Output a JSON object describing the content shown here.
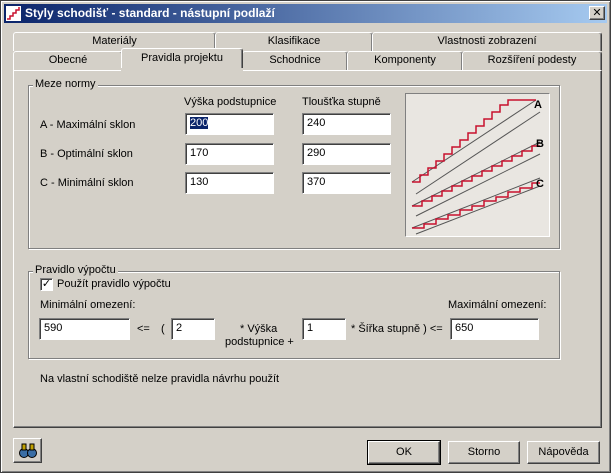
{
  "window": {
    "title": "Styly schodišť - standard - nástupní podlaží",
    "close_glyph": "✕"
  },
  "tabs_back": [
    {
      "label": "Materiály"
    },
    {
      "label": "Klasifikace"
    },
    {
      "label": "Vlastnosti zobrazení"
    }
  ],
  "tabs_front": [
    {
      "label": "Obecné"
    },
    {
      "label": "Pravidla projektu"
    },
    {
      "label": "Schodnice"
    },
    {
      "label": "Komponenty"
    },
    {
      "label": "Rozšíření podesty"
    }
  ],
  "meze": {
    "legend": "Meze normy",
    "col_vyska": "Výška podstupnice",
    "col_tloustka": "Tloušťka stupně",
    "rows": [
      {
        "label": "A - Maximální sklon",
        "vyska": "200",
        "tloustka": "240"
      },
      {
        "label": "B - Optimální sklon",
        "vyska": "170",
        "tloustka": "290"
      },
      {
        "label": "C - Minimální sklon",
        "vyska": "130",
        "tloustka": "370"
      }
    ],
    "preview_labels": [
      "A",
      "B",
      "C"
    ]
  },
  "pravidlo": {
    "legend": "Pravidlo výpočtu",
    "checkbox_label": "Použít pravidlo výpočtu",
    "checked_glyph": "✓",
    "min_label": "Minimální omezení:",
    "max_label": "Maximální omezení:",
    "min_value": "590",
    "op_le1": "<=",
    "paren_open": "(",
    "coef_vyska": "2",
    "text_vyska_1": "* Výška",
    "text_vyska_2": "podstupnice +",
    "coef_sirka": "1",
    "text_sirka": "* Šířka stupně ) <=",
    "max_value": "650"
  },
  "note": "Na vlastní schodiště nelze pravidla návrhu použít",
  "buttons": {
    "ok": "OK",
    "storno": "Storno",
    "napoveda": "Nápověda"
  },
  "colors": {
    "titlebar_start": "#0a246a",
    "titlebar_end": "#a6caf0",
    "face": "#d4d0c8",
    "stair_red": "#c8102e"
  }
}
